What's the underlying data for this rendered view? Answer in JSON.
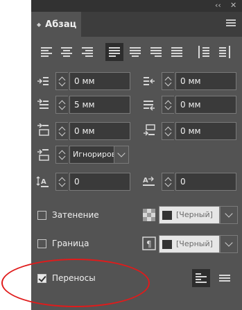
{
  "panel": {
    "tab_label": "Абзац",
    "tab_collapse_icon": "double-arrow-icon",
    "menu_icon": "hamburger-menu-icon",
    "window_controls": [
      "‹‹",
      "✕"
    ]
  },
  "alignment_buttons": [
    "align-left",
    "align-center",
    "align-right",
    "justify-last-left",
    "justify-last-center",
    "justify-last-right",
    "justify-all",
    "align-towards-spine",
    "align-away-from-spine"
  ],
  "indents": {
    "left_indent": "0 мм",
    "right_indent": "0 мм",
    "first_line_indent": "5 мм",
    "last_line_indent": "0 мм",
    "space_before": "0 мм",
    "space_after": "0 мм",
    "align_to_grid": "Игнориров"
  },
  "drop_cap": {
    "lines": "0",
    "characters": "0"
  },
  "shading": {
    "label": "Затенение",
    "checked": false,
    "swatch": "[Черный]"
  },
  "border": {
    "label": "Граница",
    "checked": false,
    "swatch": "[Черный]"
  },
  "hyphenation": {
    "label": "Переносы",
    "checked": true
  },
  "colors": {
    "panel_bg": "#535353",
    "highlight_ellipse": "#e01b1b"
  }
}
